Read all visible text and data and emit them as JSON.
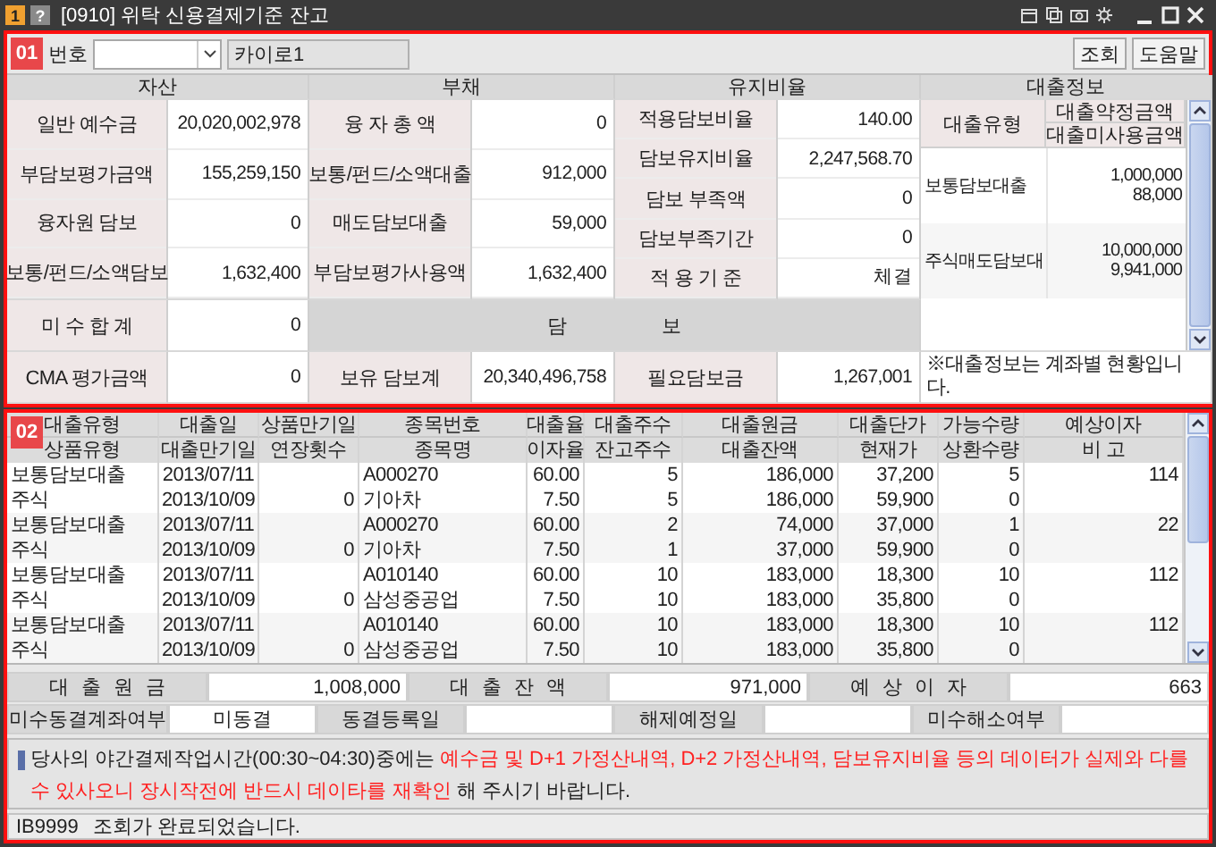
{
  "window": {
    "badge": "1",
    "help": "?",
    "title": "[0910] 위탁 신용결제기준 잔고"
  },
  "summary": {
    "badge": "01",
    "account_label": "번호",
    "account_name": "카이로1",
    "buttons": [
      "조회",
      "도움말"
    ],
    "assets": {
      "header": "자산",
      "rows": [
        {
          "label": "일반 예수금",
          "value": "20,020,002,978"
        },
        {
          "label": "부담보평가금액",
          "value": "155,259,150"
        },
        {
          "label": "융자원 담보",
          "value": "0"
        },
        {
          "label": "보통/펀드/소액담보",
          "value": "1,632,400"
        },
        {
          "label": "미 수 합 계",
          "value": "0"
        },
        {
          "label": "CMA 평가금액",
          "value": "0"
        }
      ]
    },
    "liabilities": {
      "header": "부채",
      "rows": [
        {
          "label": "융 자 총 액",
          "value": "0"
        },
        {
          "label": "보통/펀드/소액대출",
          "value": "912,000"
        },
        {
          "label": "매도담보대출",
          "value": "59,000"
        },
        {
          "label": "부담보평가사용액",
          "value": "1,632,400"
        }
      ]
    },
    "ratio": {
      "header": "유지비율",
      "rows": [
        {
          "label": "적용담보비율",
          "value": "140.00"
        },
        {
          "label": "담보유지비율",
          "value": "2,247,568.70"
        },
        {
          "label": "담보 부족액",
          "value": "0"
        },
        {
          "label": "담보부족기간",
          "value": "0"
        },
        {
          "label": "적 용 기 준",
          "value": "체결"
        }
      ]
    },
    "collateral": {
      "header": "담 보",
      "rows": [
        {
          "label": "보유 담보계",
          "value": "20,340,496,758"
        },
        {
          "label": "필요담보금",
          "value": "1,267,001"
        }
      ]
    },
    "loan_info": {
      "header": "대출정보",
      "type_header": "대출유형",
      "amount_header": "대출약정금액",
      "unused_header": "대출미사용금액",
      "rows": [
        {
          "type": "보통담보대출",
          "amount": "1,000,000",
          "unused": "88,000"
        },
        {
          "type": "주식매도담보대",
          "amount": "10,000,000",
          "unused": "9,941,000"
        }
      ],
      "note": "※대출정보는 계좌별 현황입니다."
    }
  },
  "loans": {
    "badge": "02",
    "columns": [
      {
        "top": "대출유형",
        "bottom": "상품유형"
      },
      {
        "top": "대출일",
        "bottom": "대출만기일"
      },
      {
        "top": "상품만기일",
        "bottom": "연장횟수"
      },
      {
        "top": "종목번호",
        "bottom": "종목명"
      },
      {
        "top": "대출율",
        "bottom": "이자율"
      },
      {
        "top": "대출주수",
        "bottom": "잔고주수"
      },
      {
        "top": "대출원금",
        "bottom": "대출잔액"
      },
      {
        "top": "대출단가",
        "bottom": "현재가"
      },
      {
        "top": "가능수량",
        "bottom": "상환수량"
      },
      {
        "top": "예상이자",
        "bottom": "비 고"
      }
    ],
    "records": [
      {
        "loan_type": "보통담보대출",
        "product_type": "주식",
        "loan_date": "2013/07/11",
        "due_date": "2013/10/09",
        "extensions": "0",
        "code": "A000270",
        "name": "기아차",
        "loan_rate": "60.00",
        "interest_rate": "7.50",
        "loan_qty": "5",
        "balance_qty": "5",
        "principal": "186,000",
        "balance": "186,000",
        "unit_price": "37,200",
        "current_price": "59,900",
        "avail_qty": "5",
        "repay_qty": "0",
        "expected_interest": "114"
      },
      {
        "loan_type": "보통담보대출",
        "product_type": "주식",
        "loan_date": "2013/07/11",
        "due_date": "2013/10/09",
        "extensions": "0",
        "code": "A000270",
        "name": "기아차",
        "loan_rate": "60.00",
        "interest_rate": "7.50",
        "loan_qty": "2",
        "balance_qty": "1",
        "principal": "74,000",
        "balance": "37,000",
        "unit_price": "37,000",
        "current_price": "59,900",
        "avail_qty": "1",
        "repay_qty": "0",
        "expected_interest": "22"
      },
      {
        "loan_type": "보통담보대출",
        "product_type": "주식",
        "loan_date": "2013/07/11",
        "due_date": "2013/10/09",
        "extensions": "0",
        "code": "A010140",
        "name": "삼성중공업",
        "loan_rate": "60.00",
        "interest_rate": "7.50",
        "loan_qty": "10",
        "balance_qty": "10",
        "principal": "183,000",
        "balance": "183,000",
        "unit_price": "18,300",
        "current_price": "35,800",
        "avail_qty": "10",
        "repay_qty": "0",
        "expected_interest": "112"
      },
      {
        "loan_type": "보통담보대출",
        "product_type": "주식",
        "loan_date": "2013/07/11",
        "due_date": "2013/10/09",
        "extensions": "0",
        "code": "A010140",
        "name": "삼성중공업",
        "loan_rate": "60.00",
        "interest_rate": "7.50",
        "loan_qty": "10",
        "balance_qty": "10",
        "principal": "183,000",
        "balance": "183,000",
        "unit_price": "18,300",
        "current_price": "35,800",
        "avail_qty": "10",
        "repay_qty": "0",
        "expected_interest": "112"
      }
    ],
    "totals": [
      {
        "label": "대 출 원 금",
        "value": "1,008,000"
      },
      {
        "label": "대 출 잔 액",
        "value": "971,000"
      },
      {
        "label": "예 상 이 자",
        "value": "663"
      }
    ],
    "freeze": [
      {
        "label": "미수동결계좌여부",
        "value": "미동결"
      },
      {
        "label": "동결등록일"
      },
      {
        "label": "해제예정일"
      },
      {
        "label": "미수해소여부"
      }
    ],
    "notice": [
      {
        "text": "당사의 야간결제작업시간(00:30~04:30)중에는 ",
        "highlight": false
      },
      {
        "text": "예수금 및 D+1 가정산내역, D+2 가정산내역, 담보유지비율 등의 데이터가 실제와 다를 수 있사오니 장시작전에 반드시 데이타를 재확인",
        "highlight": true
      },
      {
        "text": " 해 주시기 바랍니다.",
        "highlight": false
      }
    ]
  },
  "status_bar": {
    "code": "IB9999",
    "message": "조회가 완료되었습니다."
  }
}
